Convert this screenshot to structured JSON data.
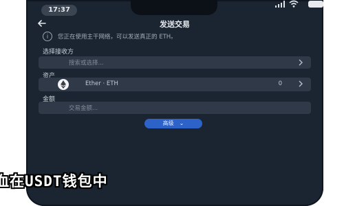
{
  "status_bar": {
    "time": "17:37"
  },
  "header": {
    "title": "发送交易"
  },
  "notice": {
    "text": "您正在使用主干网络，可以发送真正的 ETH。"
  },
  "network": {
    "label": "选择接收方",
    "placeholder": "搜索或选择..."
  },
  "asset": {
    "label": "资产",
    "token": "Ether · ETH",
    "amount": "0"
  },
  "amount": {
    "label": "金额",
    "placeholder": "交易金额..."
  },
  "advanced": {
    "label": "高级"
  },
  "overlay": {
    "text": "血在USDT钱包中"
  },
  "colors": {
    "background": "#1b2531",
    "field": "#2f3947",
    "accent": "#2d63c8",
    "text": "#e8ecf1"
  }
}
